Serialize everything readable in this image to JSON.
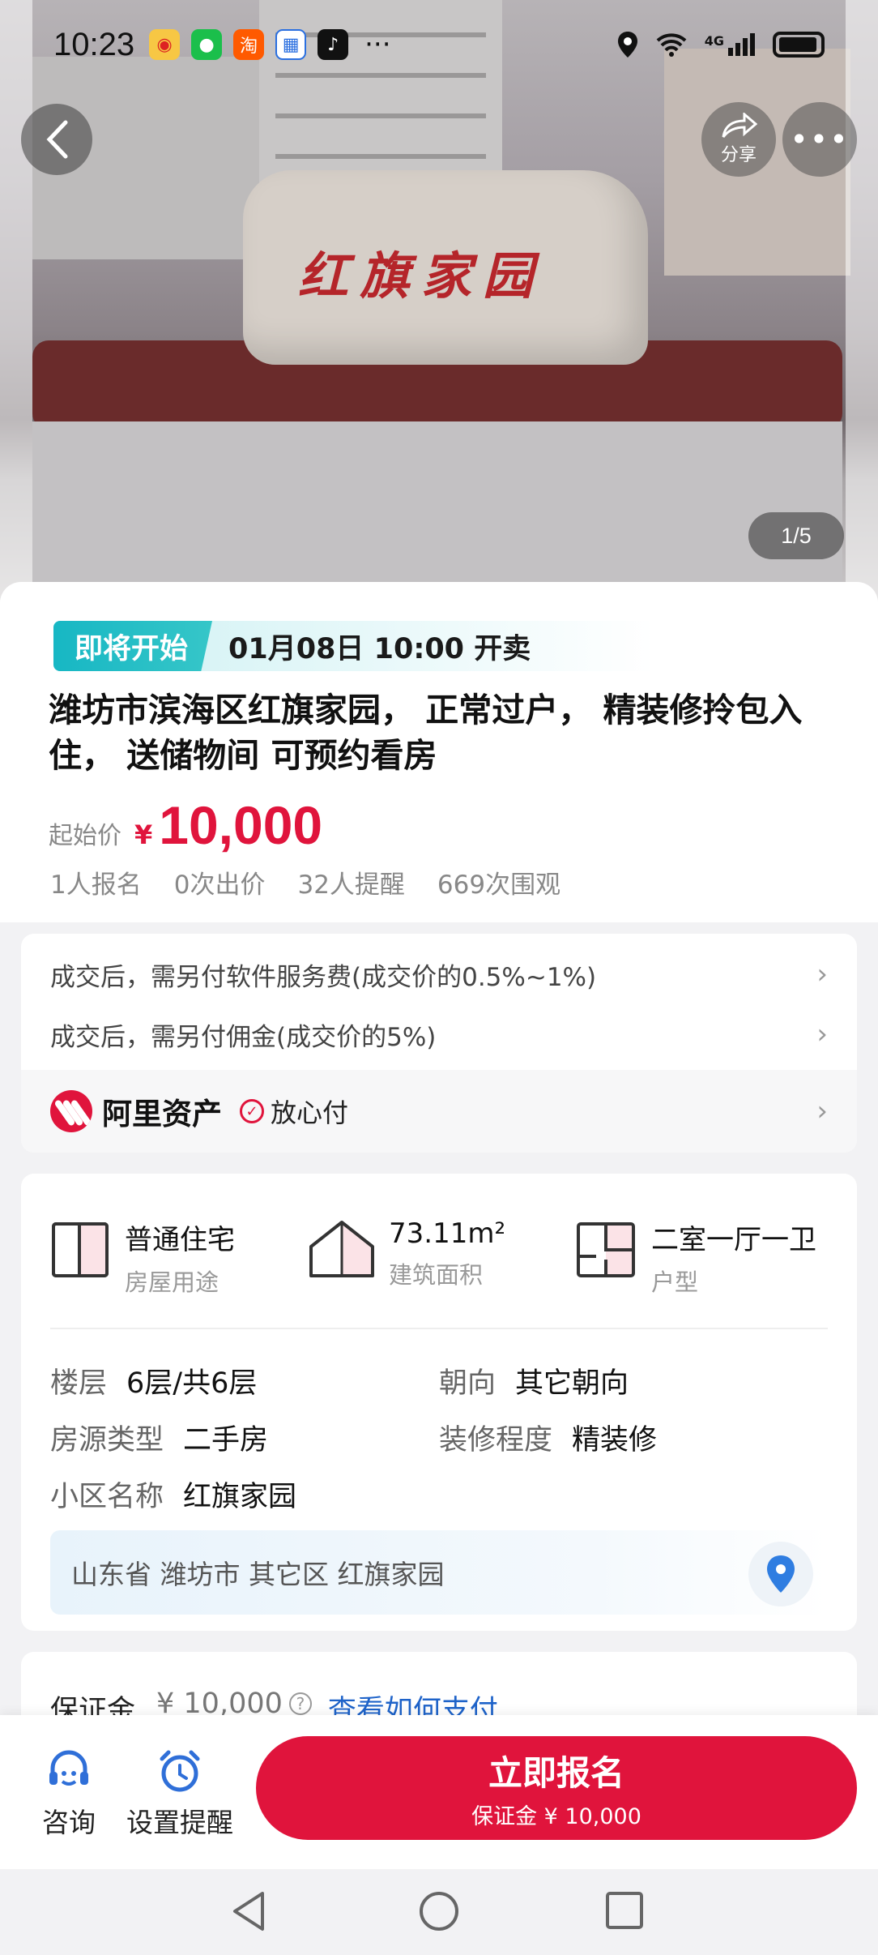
{
  "status_bar": {
    "time": "10:23",
    "network": "4G",
    "apps": [
      "weibo-icon",
      "wechat-icon",
      "taobao-icon",
      "calendar-icon",
      "tiktok-icon"
    ]
  },
  "hero": {
    "rock_text": "红旗家园",
    "share_label": "分享",
    "image_counter": "1/5"
  },
  "listing": {
    "badge": "即将开始",
    "start_time": "01月08日 10:00 开卖",
    "title": "潍坊市滨海区红旗家园， 正常过户， 精装修拎包入住， 送储物间 可预约看房",
    "price_label": "起始价",
    "currency": "¥",
    "price": "10,000",
    "stats": [
      "1人报名",
      "0次出价",
      "32人提醒",
      "669次围观"
    ]
  },
  "fees": {
    "service_fee": "成交后，需另付软件服务费(成交价的0.5%~1%)",
    "commission": "成交后，需另付佣金(成交价的5%)",
    "platform_name": "阿里资产",
    "safe_pay": "放心付"
  },
  "specs": {
    "usage_value": "普通住宅",
    "usage_label": "房屋用途",
    "area_value": "73.11m²",
    "area_label": "建筑面积",
    "layout_value": "二室一厅一卫",
    "layout_label": "户型"
  },
  "details": {
    "floor_k": "楼层",
    "floor_v": "6层/共6层",
    "orient_k": "朝向",
    "orient_v": "其它朝向",
    "type_k": "房源类型",
    "type_v": "二手房",
    "deco_k": "装修程度",
    "deco_v": "精装修",
    "community_k": "小区名称",
    "community_v": "红旗家园",
    "address": "山东省 潍坊市 其它区 红旗家园"
  },
  "deposit": {
    "label": "保证金",
    "value": "¥ 10,000",
    "link": "查看如何支付"
  },
  "bottom": {
    "consult": "咨询",
    "remind": "设置提醒",
    "cta_main": "立即报名",
    "cta_sub": "保证金 ¥ 10,000"
  },
  "colors": {
    "accent": "#e0143c",
    "badge": "#17b7c4",
    "link": "#1e63c9"
  }
}
